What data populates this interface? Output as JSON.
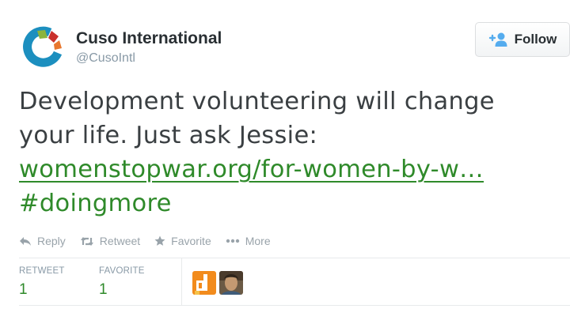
{
  "account": {
    "name": "Cuso International",
    "handle": "@CusoIntl"
  },
  "follow_button": {
    "label": "Follow",
    "icon": "add-user-icon"
  },
  "tweet": {
    "line1": "Development volunteering will change",
    "line2": "your life. Just ask Jessie:",
    "link_text": "womenstopwar.org/for-women-by-w…",
    "hashtag": "#doingmore"
  },
  "actions": [
    {
      "label": "Reply",
      "icon": "reply-icon"
    },
    {
      "label": "Retweet",
      "icon": "retweet-icon"
    },
    {
      "label": "Favorite",
      "icon": "star-icon"
    },
    {
      "label": "More",
      "icon": "more-dots-icon"
    }
  ],
  "stats": {
    "retweet_label": "RETWEET",
    "retweet_count": "1",
    "favorite_label": "FAVORITE",
    "favorite_count": "1"
  },
  "colors": {
    "link_green": "#2f8a2a",
    "muted": "#8899a6",
    "text": "#292f33"
  }
}
